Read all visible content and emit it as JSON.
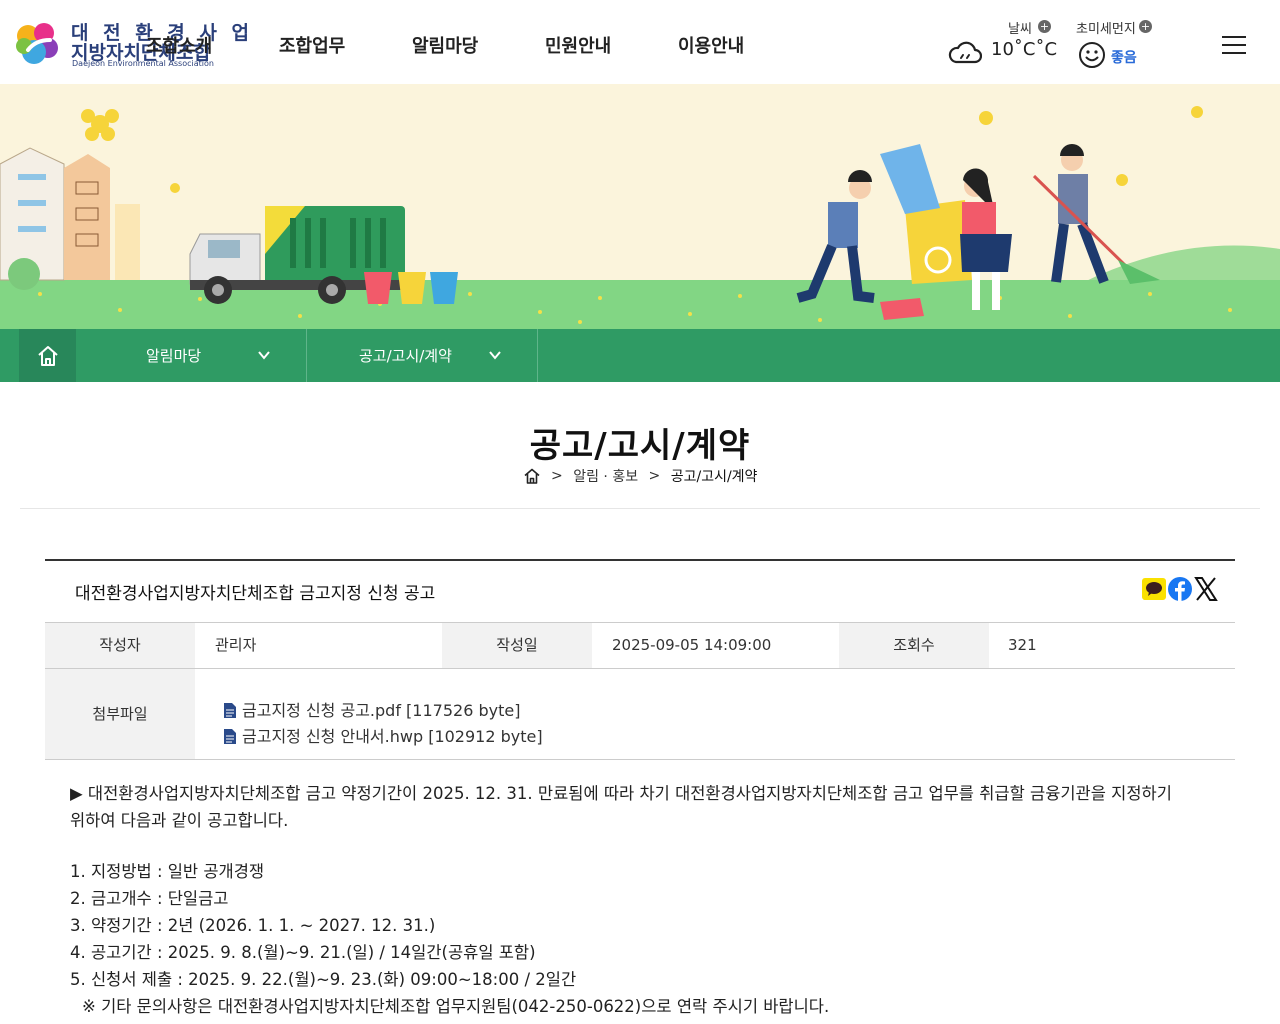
{
  "logo": {
    "line1": "대 전 환 경 사 업",
    "line2": "지방자치단체조합",
    "line3": "Daejeon Environmental Association"
  },
  "gnb": [
    "조합소개",
    "조합업무",
    "알림마당",
    "민원안내",
    "이용안내"
  ],
  "weather": {
    "label": "날씨",
    "temp": "10˚C˚C",
    "icon": "cloud-icon"
  },
  "dust": {
    "label": "초미세먼지",
    "status": "좋음",
    "icon": "smile-face-icon"
  },
  "locbar": {
    "depth1": "알림마당",
    "depth2": "공고/고시/계약"
  },
  "page_title": "공고/고시/계약",
  "breadcrumb": {
    "parent": "알림 · 홍보",
    "current": "공고/고시/계약"
  },
  "post": {
    "subject": "대전환경사업지방자치단체조합 금고지정 신청 공고",
    "author_label": "작성자",
    "author": "관리자",
    "date_label": "작성일",
    "date": "2025-09-05 14:09:00",
    "views_label": "조회수",
    "views": "321",
    "files_label": "첨부파일",
    "files": [
      "금고지정 신청 공고.pdf [117526 byte]",
      "금고지정 신청 안내서.hwp [102912 byte]"
    ],
    "body_intro_1": "▶ 대전환경사업지방자치단체조합 금고 약정기간이 2025. 12. 31. 만료됨에 따라 차기 대전환경사업지방자치단체조합 금고 업무를 취급할 금융기관을 지정하기",
    "body_intro_2": "위하여 다음과 같이 공고합니다.",
    "body_items": [
      "1. 지정방법 : 일반 공개경쟁",
      "2. 금고개수 : 단일금고",
      "3. 약정기간 : 2년 (2026. 1. 1. ~ 2027. 12. 31.)",
      "4. 공고기간 : 2025. 9. 8.(월)~9. 21.(일) / 14일간(공휴일 포함)",
      "5. 신청서 제출 : 2025. 9. 22.(월)~9. 23.(화) 09:00~18:00 / 2일간"
    ],
    "body_note": "※ 기타 문의사항은 대전환경사업지방자치단체조합 업무지원팀(042-250-0622)으로 연락 주시기 바랍니다."
  },
  "colors": {
    "green": "#2f9b64",
    "green_dark": "#28875a",
    "brand_navy": "#2a3f7a",
    "status_blue": "#2a6bd8"
  }
}
